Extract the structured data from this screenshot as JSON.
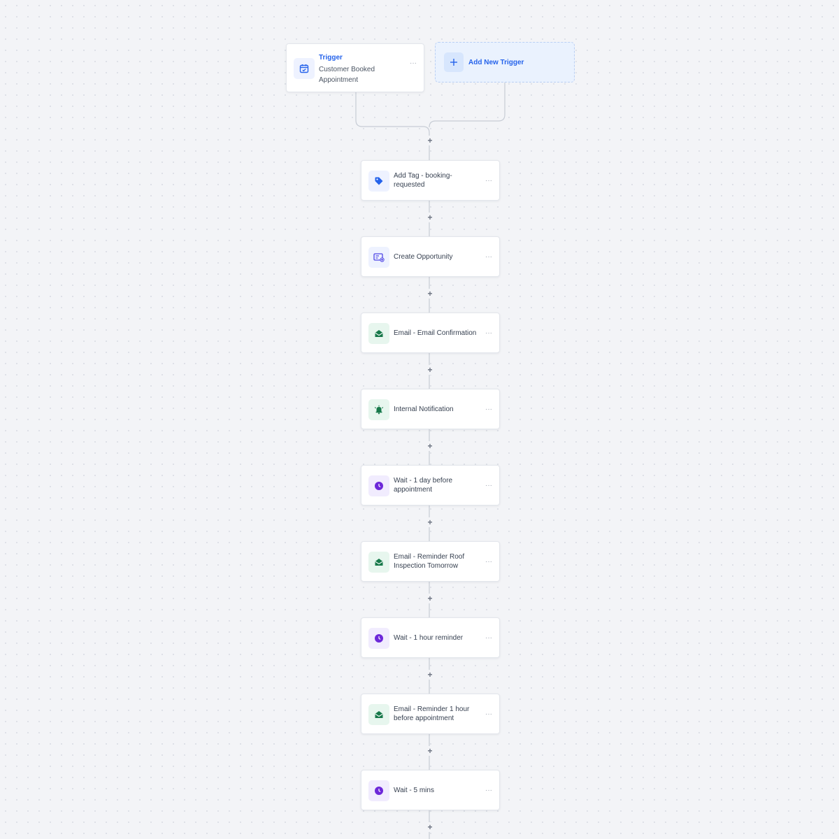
{
  "trigger": {
    "label": "Trigger",
    "name": "Customer Booked Appointment",
    "icon": "calendar-icon",
    "menu": "···"
  },
  "add_trigger": {
    "label": "Add New Trigger",
    "icon": "plus-icon"
  },
  "steps": [
    {
      "label": "Add Tag - booking-requested",
      "icon": "tag-icon",
      "menu": "···"
    },
    {
      "label": "Create Opportunity",
      "icon": "opportunity-icon",
      "menu": "···"
    },
    {
      "label": "Email - Email Confirmation",
      "icon": "email-icon",
      "menu": "···"
    },
    {
      "label": "Internal Notification",
      "icon": "bell-icon",
      "menu": "···"
    },
    {
      "label": "Wait - 1 day before appointment",
      "icon": "clock-icon",
      "menu": "···"
    },
    {
      "label": "Email - Reminder Roof Inspection Tomorrow",
      "icon": "email-icon",
      "menu": "···"
    },
    {
      "label": "Wait - 1 hour reminder",
      "icon": "clock-icon",
      "menu": "···"
    },
    {
      "label": "Email - Reminder 1 hour before appointment",
      "icon": "email-icon",
      "menu": "···"
    },
    {
      "label": "Wait - 5 mins",
      "icon": "clock-icon",
      "menu": "···"
    }
  ],
  "add_step_symbol": "+",
  "colors": {
    "accent_blue": "#2563eb",
    "email_green": "#17794a",
    "wait_purple": "#6d28d9"
  }
}
